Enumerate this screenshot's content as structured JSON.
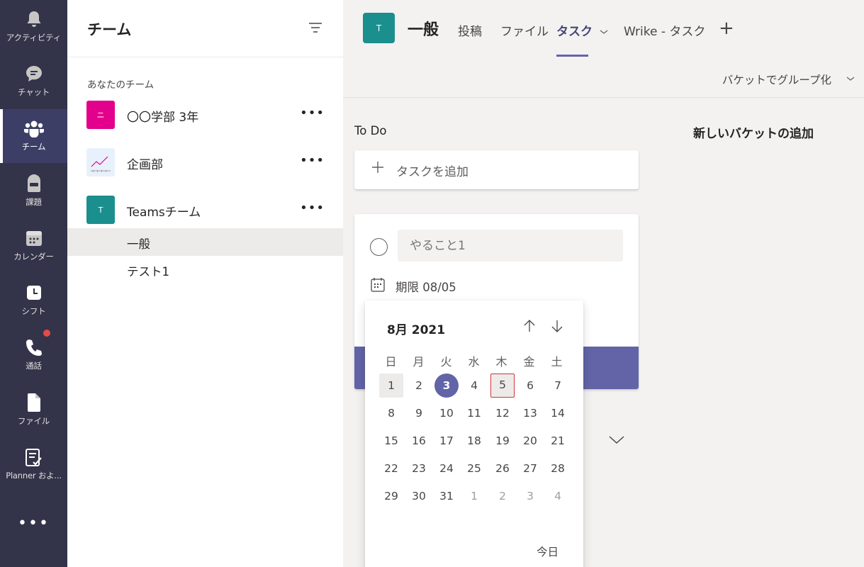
{
  "rail": {
    "items": [
      {
        "label": "アクティビティ",
        "icon": "bell-icon"
      },
      {
        "label": "チャット",
        "icon": "chat-icon"
      },
      {
        "label": "チーム",
        "icon": "teams-icon"
      },
      {
        "label": "課題",
        "icon": "backpack-icon"
      },
      {
        "label": "カレンダー",
        "icon": "calendar-icon"
      },
      {
        "label": "シフト",
        "icon": "clock-icon"
      },
      {
        "label": "通話",
        "icon": "phone-icon"
      },
      {
        "label": "ファイル",
        "icon": "file-icon"
      },
      {
        "label": "Planner およ...",
        "icon": "planner-icon"
      }
    ],
    "more": "•••",
    "active_color": "#ffffff",
    "badge_color": "#e34a4a"
  },
  "panel": {
    "title": "チーム",
    "section_label": "あなたのチーム",
    "teams": [
      {
        "name": "〇〇学部 3年",
        "avatar": "ニ",
        "color": "#e3008c"
      },
      {
        "name": "企画部",
        "avatar": "",
        "color": "#e8f1fb"
      },
      {
        "name": "Teamsチーム",
        "avatar": "T",
        "color": "#1b8e8e"
      }
    ],
    "more": "•••",
    "channels": [
      {
        "name": "一般"
      },
      {
        "name": "テスト1"
      }
    ]
  },
  "header": {
    "avatar": "T",
    "title": "一般",
    "tabs": {
      "posts": "投稿",
      "files": "ファイル",
      "tasks": "タスク",
      "wrike": "Wrike - タスク"
    },
    "add": "+",
    "accent": "#6264a7"
  },
  "subbar": {
    "group_by": "バケットでグループ化"
  },
  "board": {
    "bucket_title": "To Do",
    "new_bucket": "新しいバケットの追加",
    "add_task": "タスクを追加",
    "task_placeholder": "やること1",
    "due": "期限 08/05"
  },
  "datepicker": {
    "month": "8月 2021",
    "weekdays": [
      "日",
      "月",
      "火",
      "水",
      "木",
      "金",
      "土"
    ],
    "weeks": [
      [
        "1",
        "2",
        "3",
        "4",
        "5",
        "6",
        "7"
      ],
      [
        "8",
        "9",
        "10",
        "11",
        "12",
        "13",
        "14"
      ],
      [
        "15",
        "16",
        "17",
        "18",
        "19",
        "20",
        "21"
      ],
      [
        "22",
        "23",
        "24",
        "25",
        "26",
        "27",
        "28"
      ],
      [
        "29",
        "30",
        "31",
        "1",
        "2",
        "3",
        "4"
      ]
    ],
    "today_button": "今日"
  }
}
